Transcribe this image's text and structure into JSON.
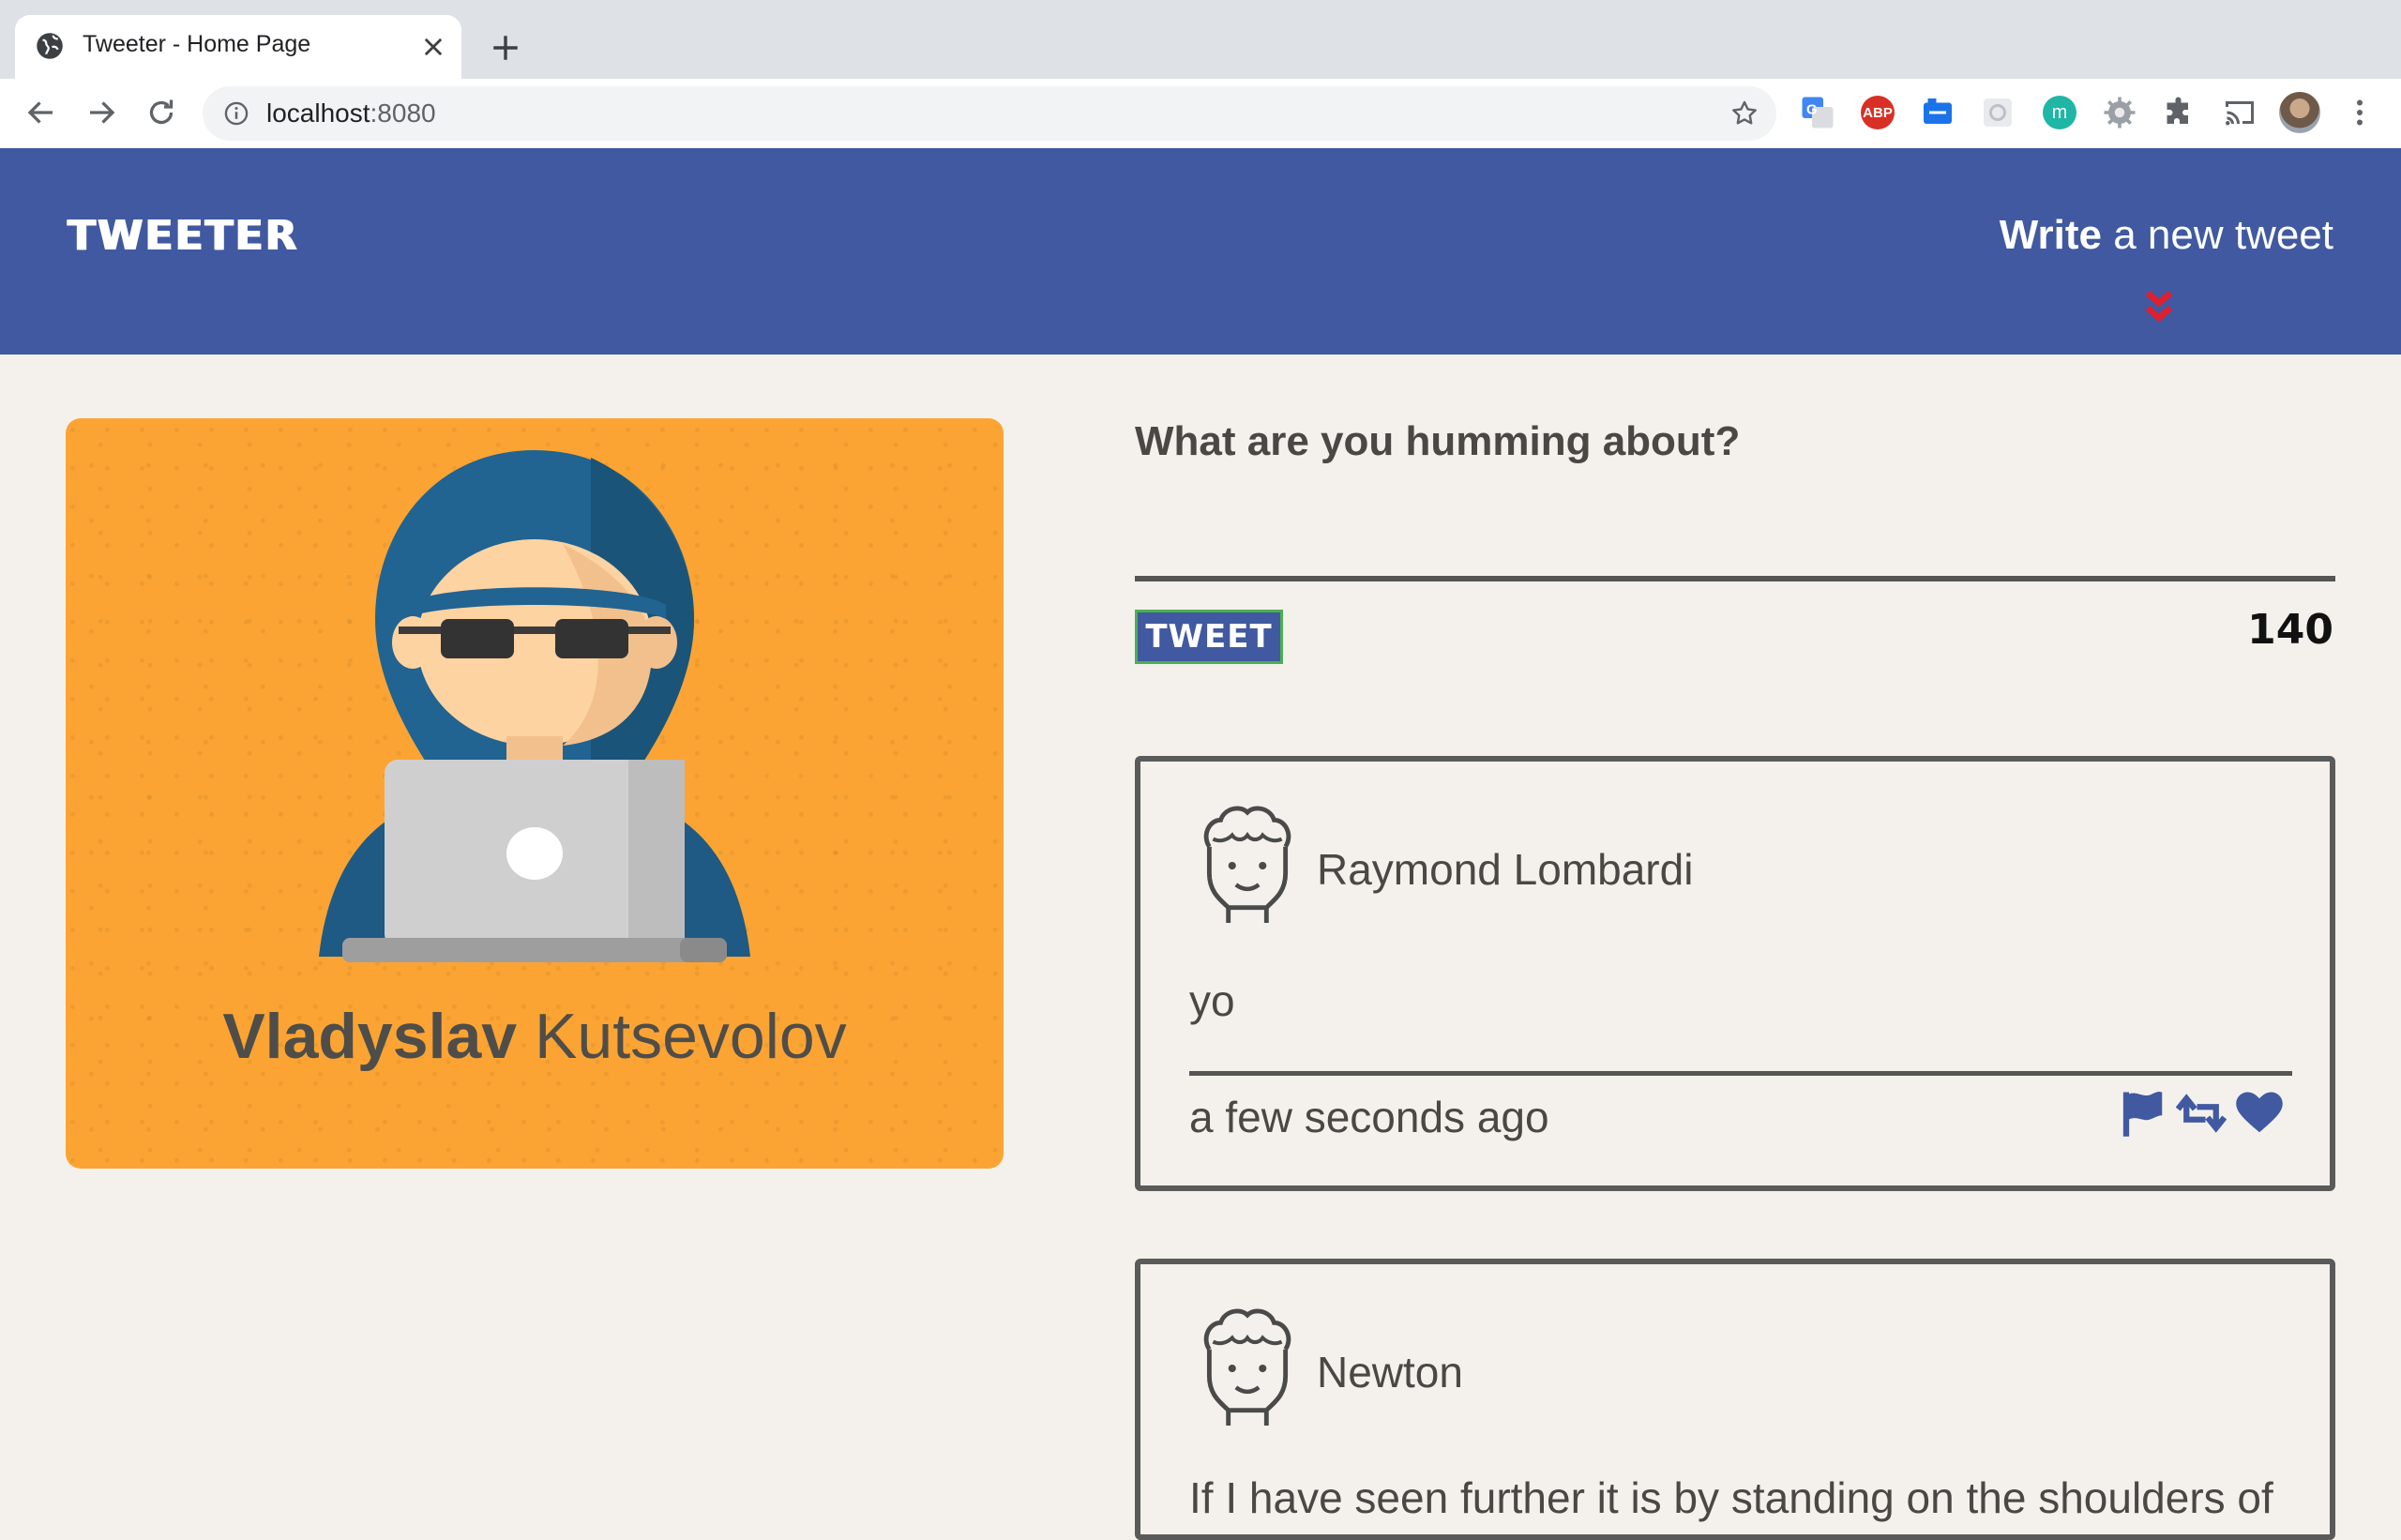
{
  "browser": {
    "tab_title": "Tweeter - Home Page",
    "url_host": "localhost",
    "url_port": ":8080",
    "extensions": [
      "google-translate-icon",
      "adblock-plus-icon",
      "extension-blue-icon",
      "extension-grey-icon",
      "extension-m-icon",
      "settings-gear-icon",
      "extensions-puzzle-icon",
      "cast-icon"
    ],
    "abp_label": "ABP",
    "m_label": "m"
  },
  "header": {
    "logo": "TWEETER",
    "compose_bold": "Write",
    "compose_rest": " a new tweet"
  },
  "profile": {
    "first_name": "Vladyslav",
    "last_name": "Kutsevolov"
  },
  "composer": {
    "label": "What are you humming about?",
    "placeholder": "",
    "button_label": "TWEET",
    "counter": "140"
  },
  "tweets": [
    {
      "author": "Raymond Lombardi",
      "body": "yo",
      "time": "a few seconds ago"
    },
    {
      "author": "Newton",
      "body": "If I have seen further it is by standing on the shoulders of"
    }
  ],
  "colors": {
    "header_bg": "#4059a0",
    "profile_bg": "#fba433",
    "page_bg": "#f4f1ec",
    "accent_red": "#e0202e",
    "tweet_button_border": "#4caf50"
  }
}
